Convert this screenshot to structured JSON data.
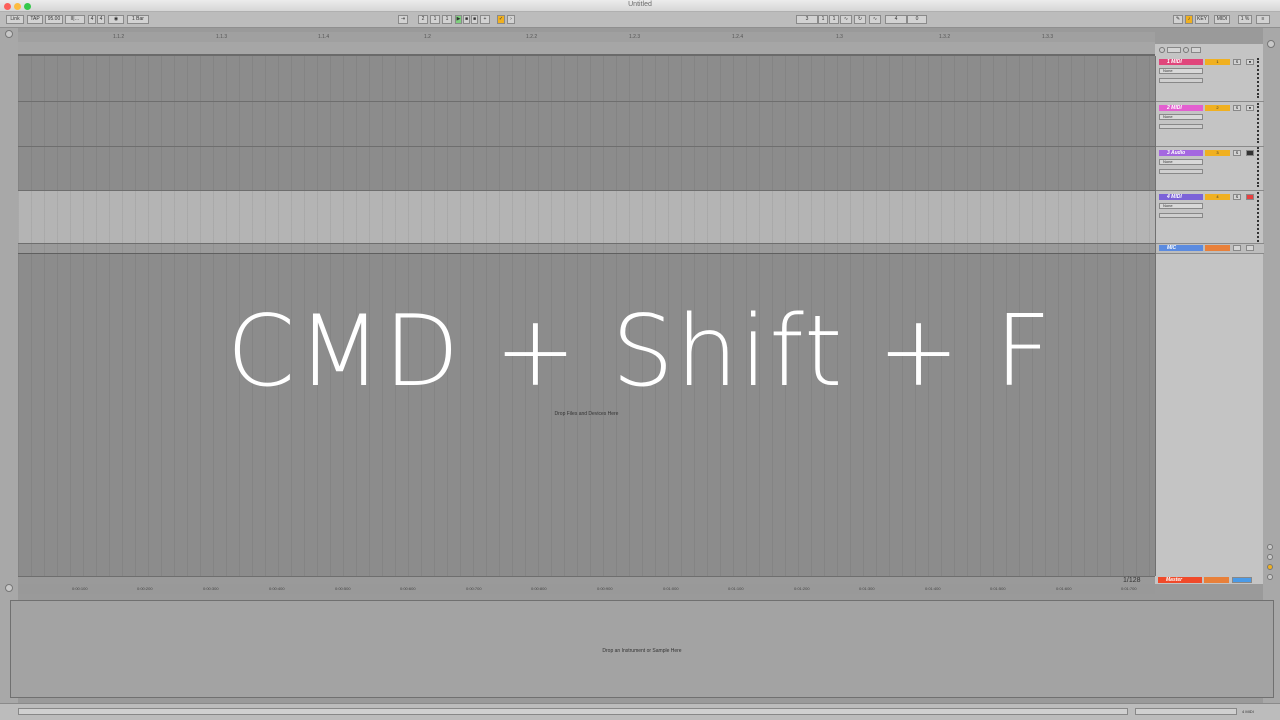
{
  "window": {
    "title": "Untitled"
  },
  "toolbar": {
    "link": "Link",
    "tap": "TAP",
    "tempo": "95.00",
    "sig_num": "4",
    "sig_den": "4",
    "quantize": "1 Bar",
    "pos_bar": "2",
    "pos_beat": "1",
    "pos_sixteenth": "1",
    "loop_start_bar": "3",
    "loop_start_beat": "1",
    "loop_start_sixteenth": "1",
    "loop_len": "4",
    "loop_len_beat": "0",
    "key": "KEY",
    "midi": "MIDI",
    "cpu": "1 %"
  },
  "ruler": {
    "markers": [
      "1.1.2",
      "1.1.3",
      "1.1.4",
      "1.2",
      "1.2.2",
      "1.2.3",
      "1.2.4",
      "1.3",
      "1.3.2",
      "1.3.3"
    ]
  },
  "time_ruler": {
    "labels": [
      "0:00:100",
      "0:00:200",
      "0:00:300",
      "0:00:400",
      "0:00:500",
      "0:00:600",
      "0:00:700",
      "0:00:800",
      "0:00:900",
      "0:01:000",
      "0:01:100",
      "0:01:200",
      "0:01:300",
      "0:01:400",
      "0:01:500",
      "0:01:600",
      "0:01:700"
    ]
  },
  "tracks": [
    {
      "name": "1 MIDI",
      "color": "#e0457b",
      "io": "None",
      "number": "1"
    },
    {
      "name": "2 MIDI",
      "color": "#e35fd0",
      "io": "None",
      "number": "2"
    },
    {
      "name": "3 Audio",
      "color": "#a467e0",
      "io": "None",
      "number": "3"
    },
    {
      "name": "4 MIDI",
      "color": "#7c63d8",
      "io": "None",
      "number": "4"
    },
    {
      "name": "MIC",
      "color": "#5b8be0",
      "io": "",
      "number": ""
    }
  ],
  "overlay": {
    "shortcut": "CMD + Shift + F"
  },
  "arrangement": {
    "drop_hint": "Drop Files and Devices Here",
    "zoom": "1/128"
  },
  "master": {
    "name": "Master",
    "color": "#f04a2a"
  },
  "detail": {
    "drop_hint": "Drop an Instrument or Sample Here"
  },
  "statusbar": {
    "track_label": "4 MIDI"
  }
}
